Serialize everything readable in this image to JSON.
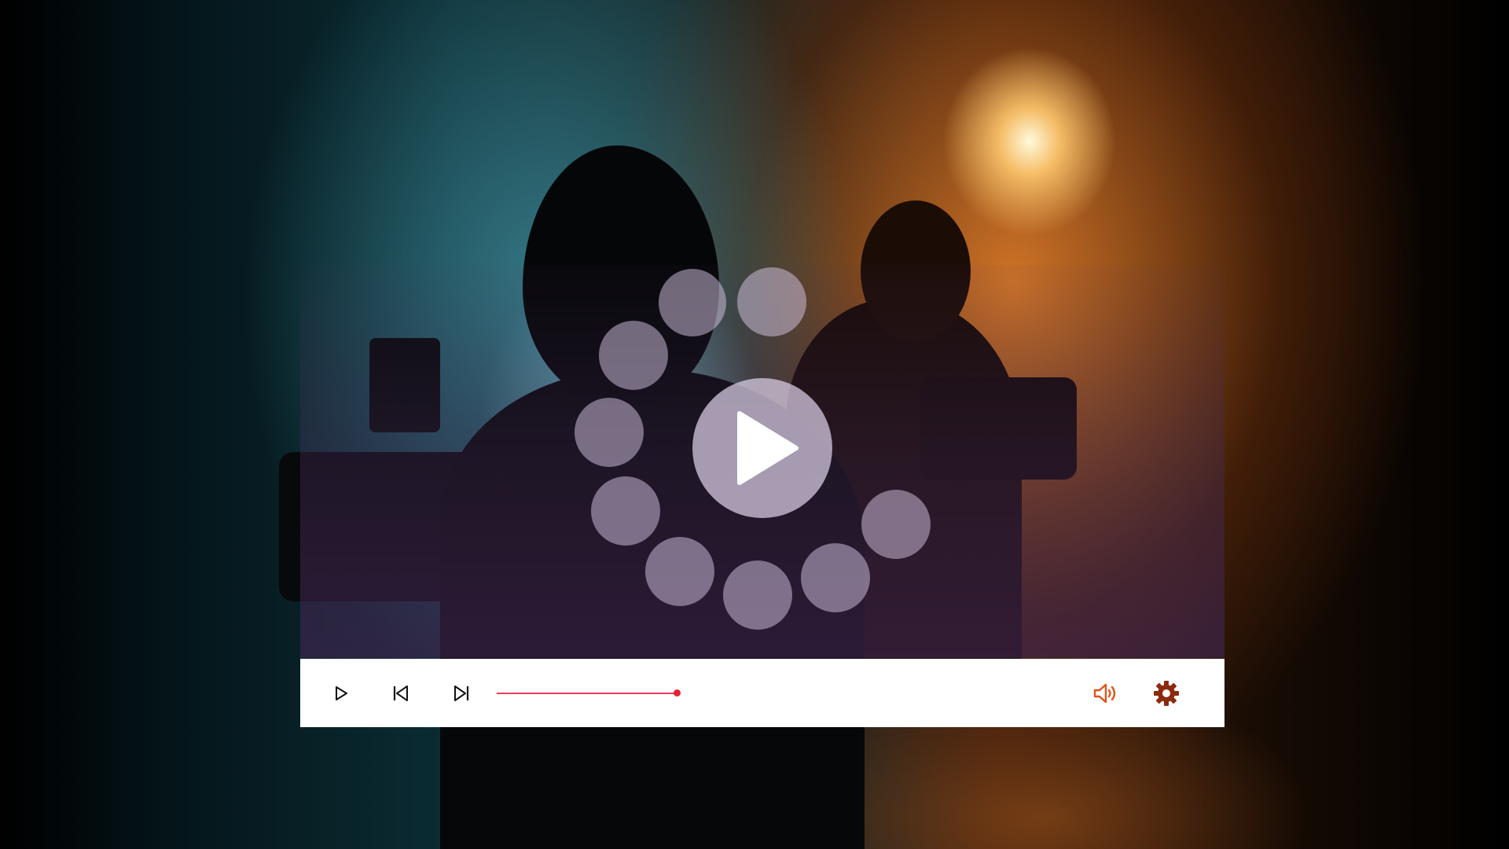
{
  "player": {
    "progress_fraction": 0.44,
    "state": "paused-loading",
    "accent_color": "#ef3d55",
    "thumb_color": "#e8202f",
    "volume_icon_color": "#e0531a",
    "settings_icon_color": "#8b2a0c"
  },
  "icons": {
    "play": "play-icon",
    "previous": "skip-previous-icon",
    "next": "skip-next-icon",
    "volume": "volume-icon",
    "settings": "gear-icon",
    "big_play": "play-icon",
    "loader": "loading-spinner-icon"
  }
}
